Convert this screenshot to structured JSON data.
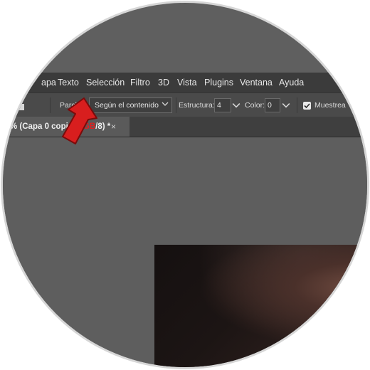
{
  "menubar": {
    "items": [
      "apa",
      "Texto",
      "Selección",
      "Filtro",
      "3D",
      "Vista",
      "Plugins",
      "Ventana",
      "Ayuda"
    ]
  },
  "options": {
    "patch_label": "Parche:",
    "patch_mode": "Según el contenido",
    "structure_label": "Estructura:",
    "structure_value": "4",
    "color_label": "Color:",
    "color_value": "0",
    "sample_label": "Muestrea"
  },
  "document_tab": {
    "title_prefix": "% (Capa 0 copia, ",
    "title_highlight": "RGB",
    "title_suffix": "/8) *",
    "close": "×"
  },
  "colors": {
    "menubar_bg": "#3b3b3b",
    "options_bg": "#4a4a4a",
    "canvas_bg": "#5e5e5e",
    "highlight_red": "#e01f1f",
    "arrow_red": "#d81e1e"
  },
  "icons": [
    "tool-mode-icon",
    "chevron-down-icon",
    "checkbox-checked-icon",
    "close-icon",
    "pointer-arrow-icon"
  ]
}
